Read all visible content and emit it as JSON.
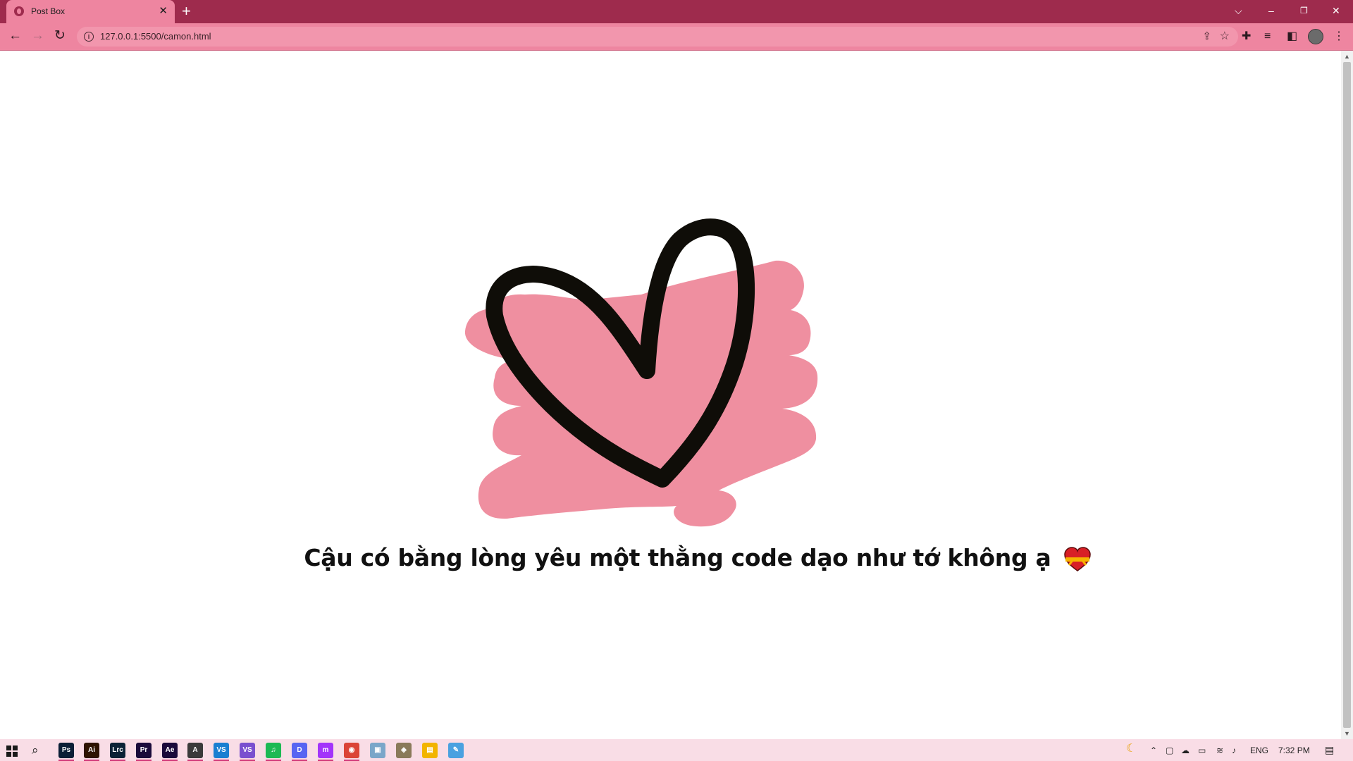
{
  "browser": {
    "tab_title": "Post Box",
    "tab_close": "✕",
    "new_tab": "+",
    "url": "127.0.0.1:5500/camon.html",
    "window_controls": {
      "dropdown": "⌵",
      "minimize": "–",
      "restore": "❐",
      "close": "✕"
    },
    "nav": {
      "back": "←",
      "forward": "→",
      "reload": "↻"
    },
    "colors": {
      "titlebar": "#9e2b4d",
      "toolbar": "#ee85a0",
      "omnibox": "#f296ad"
    }
  },
  "page": {
    "message": "Cậu có bằng lòng yêu một thằng code dạo như tớ không ạ",
    "emoji": "❤️",
    "colors": {
      "heart_fill": "#ef8fa0",
      "heart_outline": "#0f0d08",
      "text": "#111111"
    }
  },
  "taskbar": {
    "apps": [
      {
        "name": "photoshop",
        "label": "Ps",
        "color": "#0b1e36"
      },
      {
        "name": "illustrator",
        "label": "Ai",
        "color": "#2e1300"
      },
      {
        "name": "lightroom-classic",
        "label": "Lrc",
        "color": "#0b2236"
      },
      {
        "name": "premiere",
        "label": "Pr",
        "color": "#1a0a3a"
      },
      {
        "name": "after-effects",
        "label": "Ae",
        "color": "#1a0a3a"
      },
      {
        "name": "autocad",
        "label": "A",
        "color": "#3a3a3a"
      },
      {
        "name": "vscode",
        "label": "VS",
        "color": "#1a7fd1"
      },
      {
        "name": "visual-studio",
        "label": "VS",
        "color": "#7a4fcf"
      },
      {
        "name": "spotify",
        "label": "♫",
        "color": "#1db954"
      },
      {
        "name": "discord",
        "label": "D",
        "color": "#5865f2"
      },
      {
        "name": "messenger",
        "label": "m",
        "color": "#a334fa"
      },
      {
        "name": "chrome",
        "label": "◉",
        "color": "#db4437"
      },
      {
        "name": "photos",
        "label": "▣",
        "color": "#7aa6c9"
      },
      {
        "name": "gimp",
        "label": "◈",
        "color": "#8a7a5a"
      },
      {
        "name": "file-explorer",
        "label": "▤",
        "color": "#f2b400"
      },
      {
        "name": "paint",
        "label": "✎",
        "color": "#4aa1e0"
      }
    ],
    "tray": {
      "language": "ENG",
      "time": "7:32 PM"
    }
  }
}
